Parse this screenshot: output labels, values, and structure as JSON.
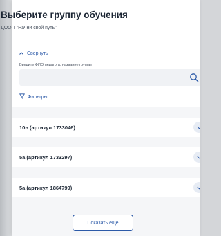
{
  "dialog": {
    "title": "Выберите группу обучения",
    "subtitle": "ДООП \"Начни свой путь\""
  },
  "filter": {
    "collapse_label": "Свернуть",
    "field_label": "Введите ФИО педагога, название группы",
    "search_value": "",
    "filters_label": "Фильтры"
  },
  "groups": [
    {
      "label": "10в (артикул 1733046)"
    },
    {
      "label": "5а (артикул 1733297)"
    },
    {
      "label": "5а (артикул 1864799)"
    }
  ],
  "show_more_label": "Показать еще",
  "colors": {
    "accent": "#2c5aa8",
    "title_text": "#1b2533",
    "panel_bg": "#f5f6f8"
  }
}
